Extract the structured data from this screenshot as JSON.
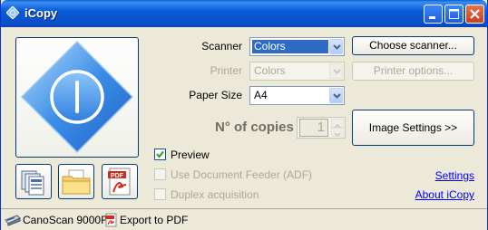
{
  "window": {
    "title": "iCopy",
    "icon": "diamond-app-icon"
  },
  "titlebar_buttons": [
    "minimize-icon",
    "maximize-icon",
    "close-icon"
  ],
  "main_button": {
    "icon": "power-icon",
    "color": "#3b8ee8"
  },
  "quick_buttons": [
    {
      "name": "multi-document-icon"
    },
    {
      "name": "folder-icon"
    },
    {
      "name": "pdf-icon",
      "text": "PDF"
    }
  ],
  "form": {
    "scanner": {
      "label": "Scanner",
      "value": "Colors"
    },
    "printer": {
      "label": "Printer",
      "value": "Colors"
    },
    "paper_size": {
      "label": "Paper Size",
      "value": "A4"
    },
    "copies": {
      "label": "N° of copies",
      "value": "1"
    }
  },
  "buttons": {
    "choose_scanner": "Choose scanner...",
    "printer_options": "Printer options...",
    "image_settings": "Image Settings >>"
  },
  "checkboxes": {
    "preview": {
      "label": "Preview",
      "checked": true
    },
    "feeder": {
      "label": "Use Document Feeder (ADF)",
      "checked": false
    },
    "duplex": {
      "label": "Duplex acquisition",
      "checked": false
    }
  },
  "links": {
    "settings": "Settings",
    "about": "About iCopy"
  },
  "statusbar": {
    "scanner_name": "CanoScan 9000F",
    "export_label": "Export to PDF"
  },
  "colors": {
    "title_blue": "#0a5fd8",
    "selection": "#316ac5",
    "link": "#0000ff"
  }
}
